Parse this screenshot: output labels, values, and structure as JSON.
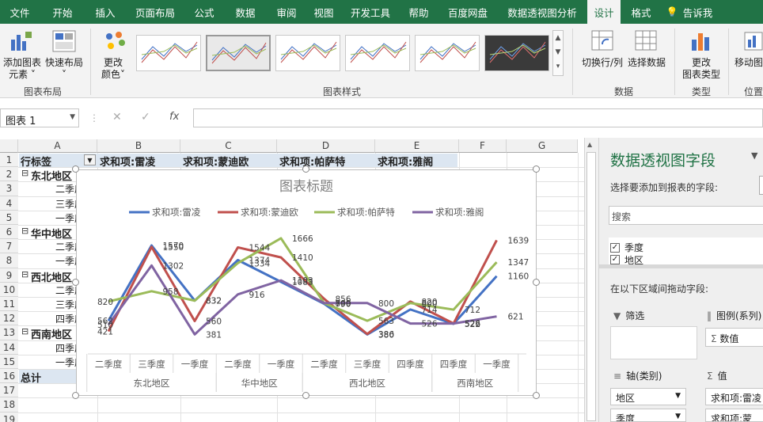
{
  "tabs": [
    "文件",
    "开始",
    "插入",
    "页面布局",
    "公式",
    "数据",
    "审阅",
    "视图",
    "开发工具",
    "帮助",
    "百度网盘",
    "数据透视图分析",
    "设计",
    "格式",
    "告诉我"
  ],
  "ribbon": {
    "add_element": "添加图表",
    "add_element2": "元素",
    "quick_layout": "快速布局",
    "change_colors": "更改",
    "change_colors2": "颜色",
    "group_layout": "图表布局",
    "group_styles": "图表样式",
    "switch_row_col": "切换行/列",
    "select_data": "选择数据",
    "group_data": "数据",
    "change_type": "更改",
    "change_type2": "图表类型",
    "group_type": "类型",
    "move_chart": "移动图",
    "group_location": "位置"
  },
  "formula_bar": {
    "name_box": "图表 1",
    "fx": "fx",
    "cancel": "✕",
    "confirm": "✓"
  },
  "columns": [
    "A",
    "B",
    "C",
    "D",
    "E",
    "F",
    "G"
  ],
  "rows": [
    "1",
    "2",
    "3",
    "4",
    "5",
    "6",
    "7",
    "8",
    "9",
    "10",
    "11",
    "12",
    "13",
    "14",
    "15",
    "16",
    "17",
    "18",
    "19"
  ],
  "cells": {
    "a1": "行标签",
    "b1": "求和项:雷凌",
    "c1": "求和项:蒙迪欧",
    "d1": "求和项:帕萨特",
    "e1": "求和项:雅阁",
    "a2": "东北地区",
    "a3": "二季度",
    "a4": "三季度",
    "a5": "一季度",
    "a6": "华中地区",
    "a7": "二季度",
    "a8": "一季度",
    "a9": "西北地区",
    "a10": "二季度",
    "a11": "三季度",
    "a12": "四季度",
    "a13": "西南地区",
    "a14": "四季度",
    "a15": "一季度",
    "a16": "总计",
    "collapse": "⊟"
  },
  "chart_data": {
    "type": "line",
    "title": "图表标题",
    "categories": [
      "二季度",
      "三季度",
      "一季度",
      "二季度",
      "一季度",
      "二季度",
      "三季度",
      "四季度",
      "四季度",
      "一季度"
    ],
    "groups": [
      {
        "name": "东北地区",
        "count": 3
      },
      {
        "name": "华中地区",
        "count": 2
      },
      {
        "name": "西北地区",
        "count": 3
      },
      {
        "name": "西南地区",
        "count": 2
      }
    ],
    "ylim": [
      300,
      1750
    ],
    "legend": "top",
    "series": [
      {
        "name": "求和项:雷凌",
        "color": "#4472C4",
        "values": [
          562,
          1570,
          832,
          1374,
          1083,
          790,
          380,
          714,
          522,
          1160
        ]
      },
      {
        "name": "求和项:蒙迪欧",
        "color": "#C0504D",
        "values": [
          421,
          1550,
          560,
          1544,
          1410,
          856,
          386,
          820,
          526,
          1639
        ]
      },
      {
        "name": "求和项:帕萨特",
        "color": "#9BBB59",
        "values": [
          820,
          958,
          832,
          1334,
          1666,
          799,
          563,
          800,
          712,
          1347
        ]
      },
      {
        "name": "求和项:雅阁",
        "color": "#8064A2",
        "values": [
          510,
          1302,
          381,
          916,
          1103,
          800,
          800,
          526,
          526,
          621
        ]
      }
    ]
  },
  "pane": {
    "title": "数据透视图字段",
    "subtitle": "选择要添加到报表的字段:",
    "search_placeholder": "搜索",
    "fields": [
      "季度",
      "地区"
    ],
    "drag_hint": "在以下区域间拖动字段:",
    "filter": "筛选",
    "legend": "图例(系列)",
    "values_item": "数值",
    "axis": "轴(类别)",
    "values": "值",
    "axis_items": [
      "地区",
      "季度"
    ],
    "value_items": [
      "求和项:雷凌",
      "求和项:蒙"
    ]
  }
}
